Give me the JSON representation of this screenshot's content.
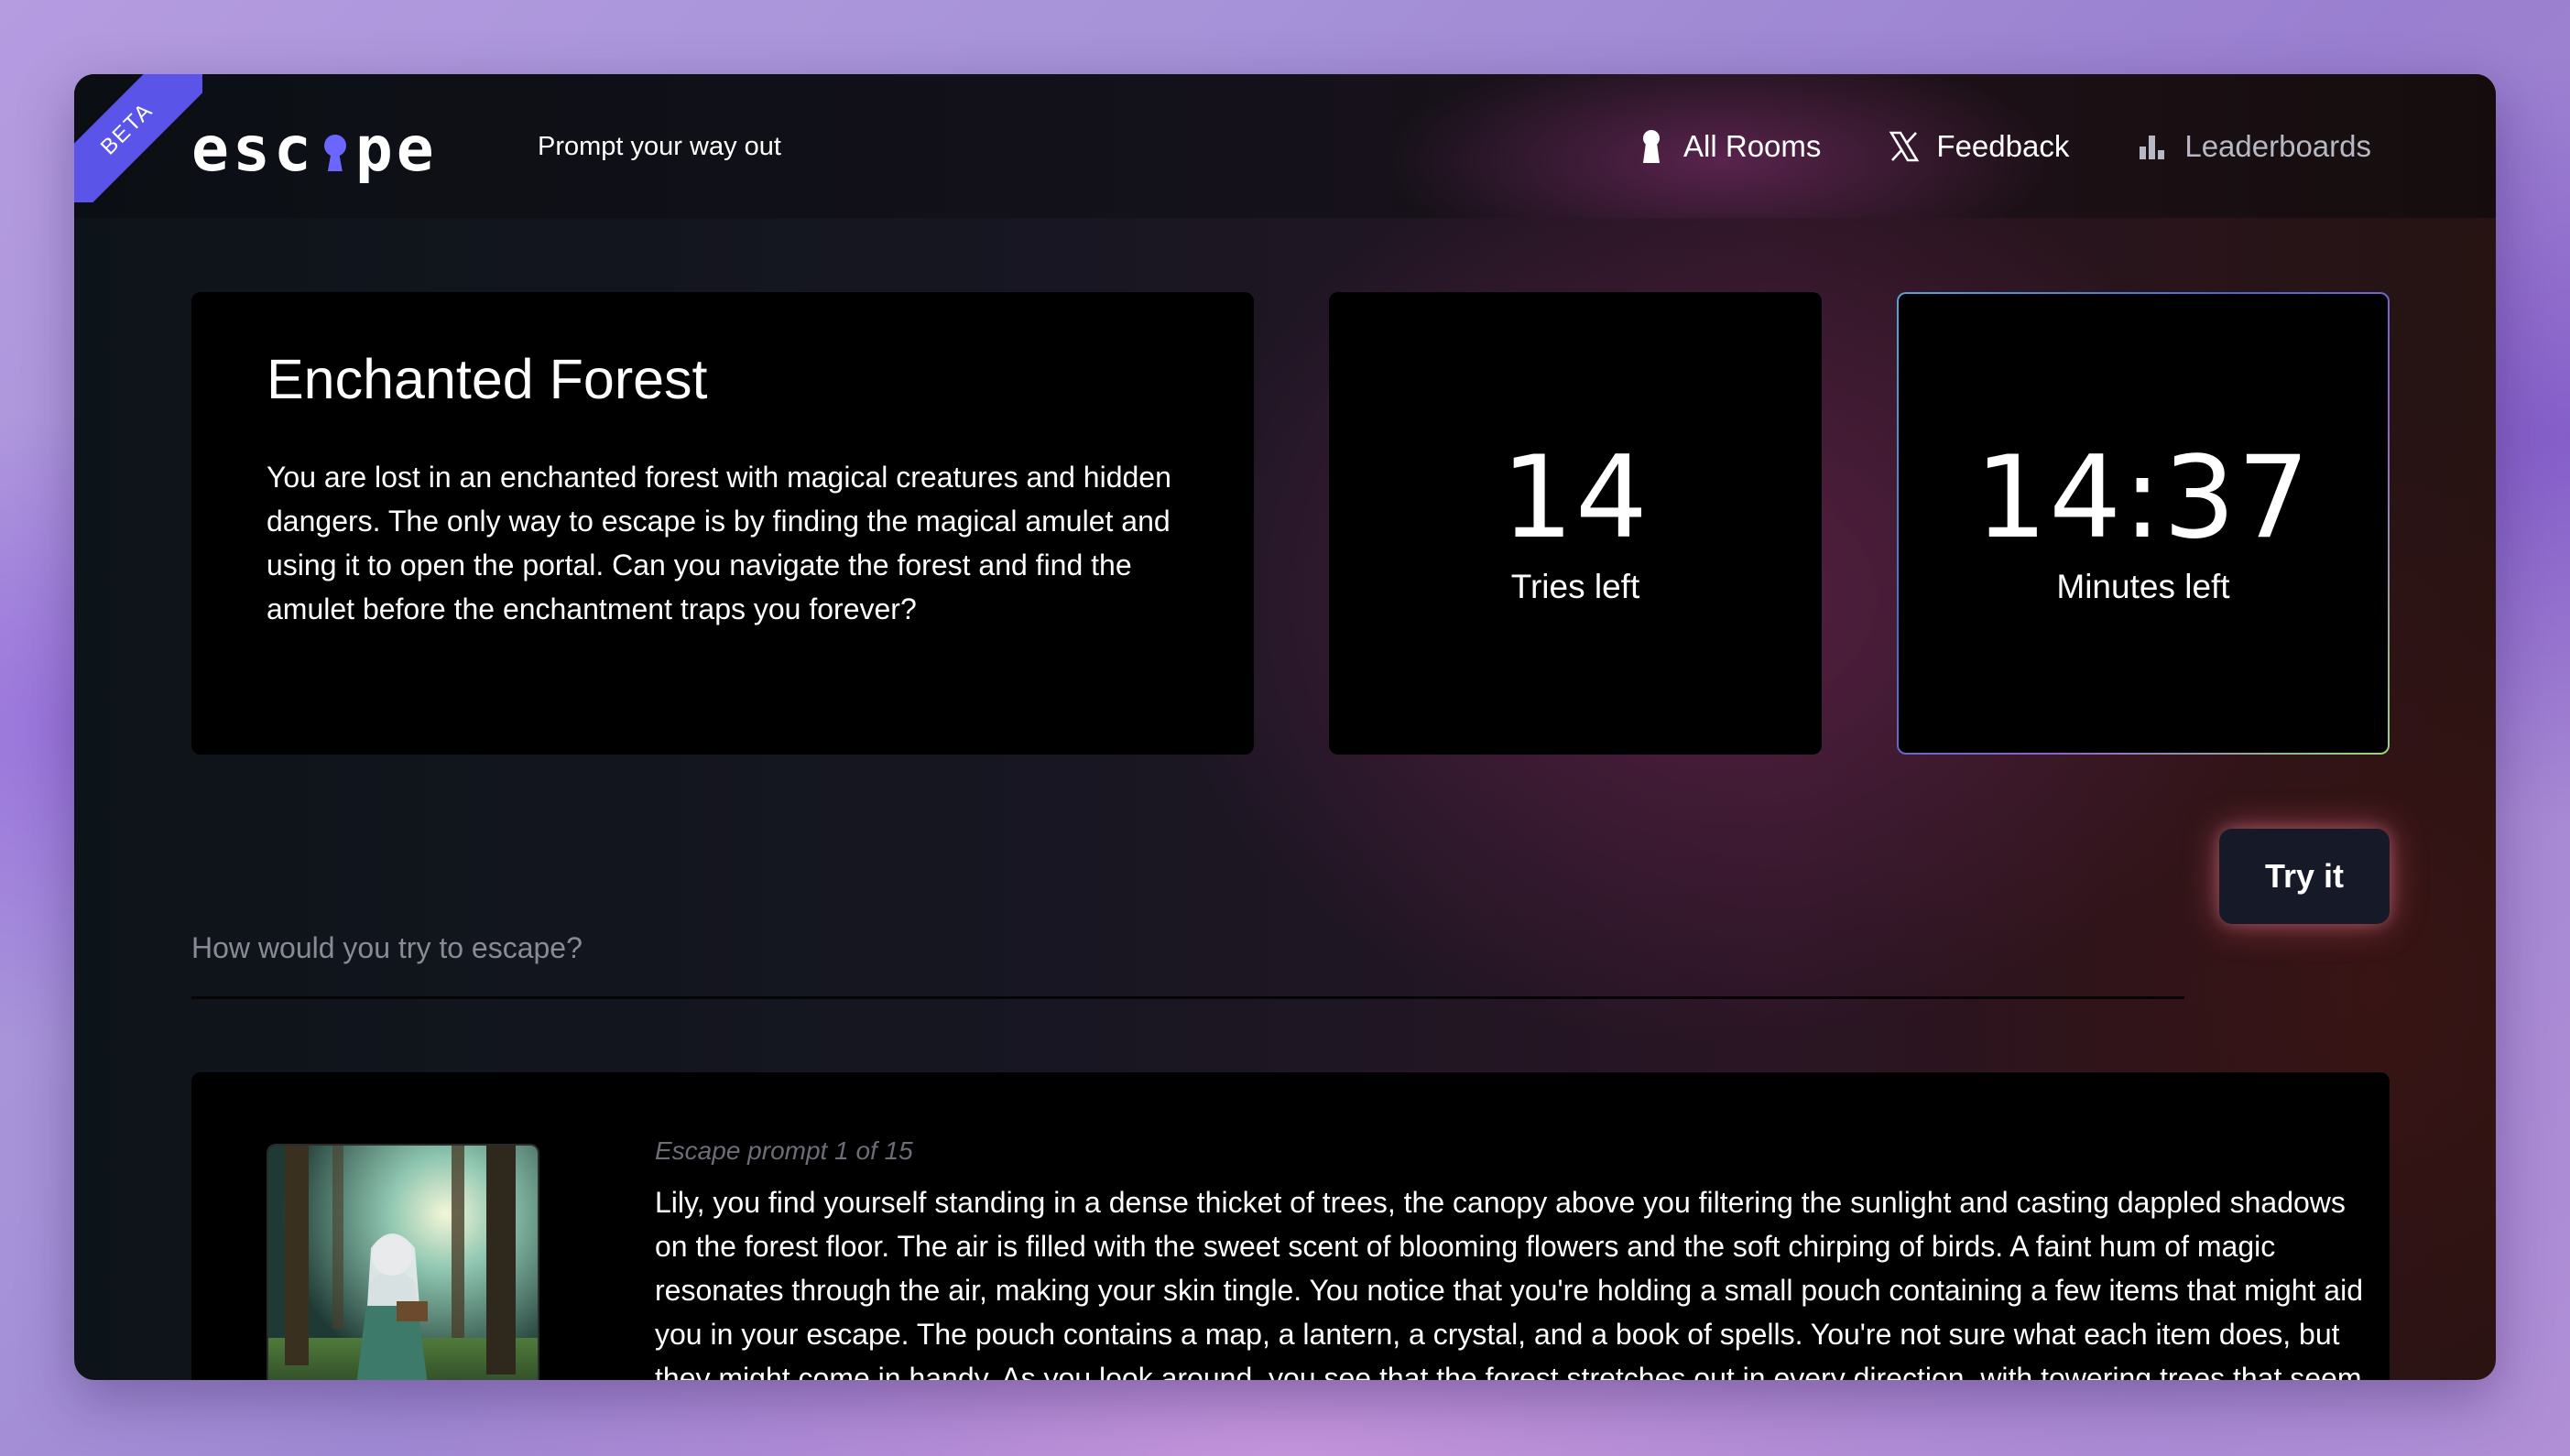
{
  "header": {
    "beta": "BETA",
    "logo_pre": "esc",
    "logo_post": "pe",
    "tagline": "Prompt your way out",
    "nav": [
      {
        "label": "All Rooms",
        "icon": "keyhole-icon"
      },
      {
        "label": "Feedback",
        "icon": "x-logo-icon"
      },
      {
        "label": "Leaderboards",
        "icon": "bar-chart-icon"
      }
    ]
  },
  "room": {
    "title": "Enchanted Forest",
    "description": "You are lost in an enchanted forest with magical creatures and hidden dangers. The only way to escape is by finding the magical amulet and using it to open the portal. Can you navigate the forest and find the amulet before the enchantment traps you forever?"
  },
  "stats": {
    "tries_value": "14",
    "tries_label": "Tries left",
    "timer_value": "14:37",
    "timer_label": "Minutes left"
  },
  "prompt": {
    "placeholder": "How would you try to escape?",
    "button_label": "Try it"
  },
  "response": {
    "meta": "Escape prompt 1 of 15",
    "text": "Lily, you find yourself standing in a dense thicket of trees, the canopy above you filtering the sunlight and casting dappled shadows on the forest floor. The air is filled with the sweet scent of blooming flowers and the soft chirping of birds. A faint hum of magic resonates through the air, making your skin tingle. You notice that you're holding a small pouch containing a few items that might aid you in your escape. The pouch contains a map, a lantern, a crystal, and a book of spells. You're not sure what each item does, but they might come in handy. As you look around, you see that the forest stretches out in every direction, with towering trees that seem to stretch up to the sky. You notice a few landmarks: a clearing to the north, a"
  },
  "colors": {
    "accent": "#5a54e8",
    "logo_keyhole": "#6b66ff",
    "button_bg": "#161a28"
  }
}
